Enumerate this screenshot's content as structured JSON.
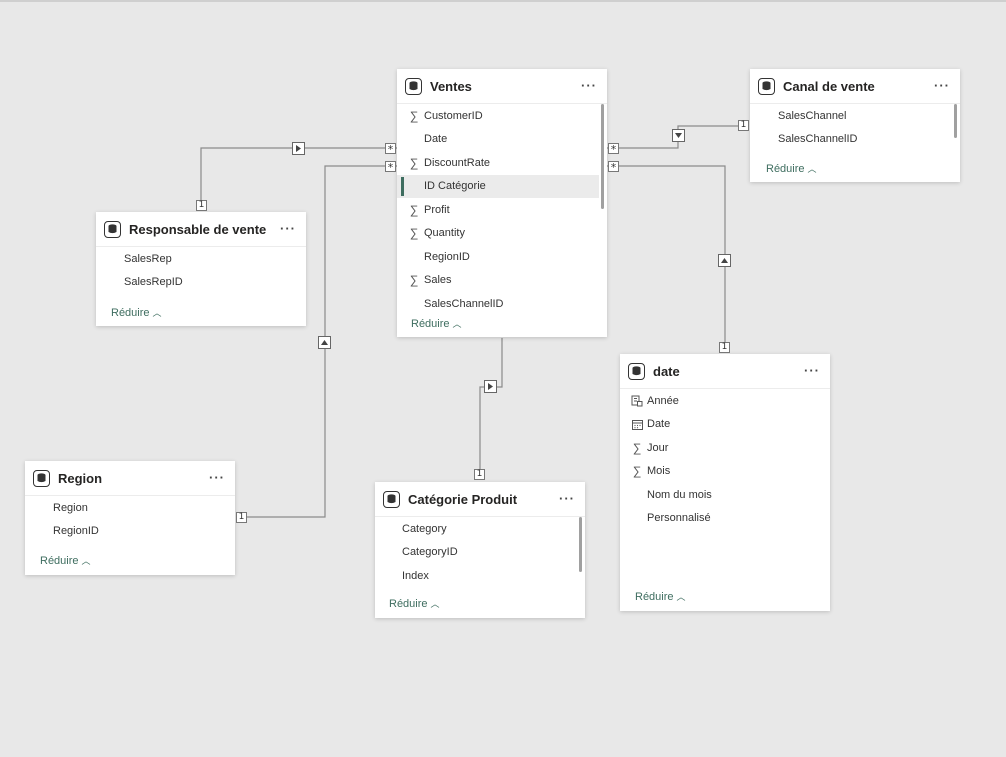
{
  "tables": {
    "ventes": {
      "title": "Ventes",
      "more": "···",
      "fields": [
        {
          "label": "CustomerID",
          "icon": "∑"
        },
        {
          "label": "Date",
          "icon": ""
        },
        {
          "label": "DiscountRate",
          "icon": "∑"
        },
        {
          "label": "ID Catégorie",
          "icon": "",
          "selected": true
        },
        {
          "label": "Profit",
          "icon": "∑"
        },
        {
          "label": "Quantity",
          "icon": "∑"
        },
        {
          "label": "RegionID",
          "icon": ""
        },
        {
          "label": "Sales",
          "icon": "∑"
        },
        {
          "label": "SalesChannelID",
          "icon": ""
        }
      ],
      "collapse": "Réduire"
    },
    "canal": {
      "title": "Canal de vente",
      "more": "···",
      "fields": [
        {
          "label": "SalesChannel",
          "icon": ""
        },
        {
          "label": "SalesChannelID",
          "icon": ""
        }
      ],
      "collapse": "Réduire"
    },
    "responsable": {
      "title": "Responsable de vente",
      "more": "···",
      "fields": [
        {
          "label": "SalesRep",
          "icon": ""
        },
        {
          "label": "SalesRepID",
          "icon": ""
        }
      ],
      "collapse": "Réduire"
    },
    "region": {
      "title": "Region",
      "more": "···",
      "fields": [
        {
          "label": "Region",
          "icon": ""
        },
        {
          "label": "RegionID",
          "icon": ""
        }
      ],
      "collapse": "Réduire"
    },
    "categorie": {
      "title": "Catégorie Produit",
      "more": "···",
      "fields": [
        {
          "label": "Category",
          "icon": ""
        },
        {
          "label": "CategoryID",
          "icon": ""
        },
        {
          "label": "Index",
          "icon": ""
        }
      ],
      "collapse": "Réduire"
    },
    "date": {
      "title": "date",
      "more": "···",
      "fields": [
        {
          "label": "Année",
          "icon": "hierarchy-icon"
        },
        {
          "label": "Date",
          "icon": "calendar-icon"
        },
        {
          "label": "Jour",
          "icon": "∑"
        },
        {
          "label": "Mois",
          "icon": "∑"
        },
        {
          "label": "Nom du mois",
          "icon": ""
        },
        {
          "label": "Personnalisé",
          "icon": ""
        }
      ],
      "collapse": "Réduire"
    }
  },
  "relationships": [
    {
      "from": "Ventes",
      "to": "Responsable de vente",
      "from_card": "*",
      "to_card": "1"
    },
    {
      "from": "Ventes",
      "to": "Region",
      "from_card": "*",
      "to_card": "1"
    },
    {
      "from": "Ventes",
      "to": "Canal de vente",
      "from_card": "*",
      "to_card": "1"
    },
    {
      "from": "Ventes",
      "to": "date",
      "from_card": "*",
      "to_card": "1"
    },
    {
      "from": "Ventes",
      "to": "Catégorie Produit",
      "from_card": "*",
      "to_card": "1"
    }
  ],
  "colors": {
    "accent": "#3e6d5f",
    "canvas": "#e8e8e8"
  }
}
